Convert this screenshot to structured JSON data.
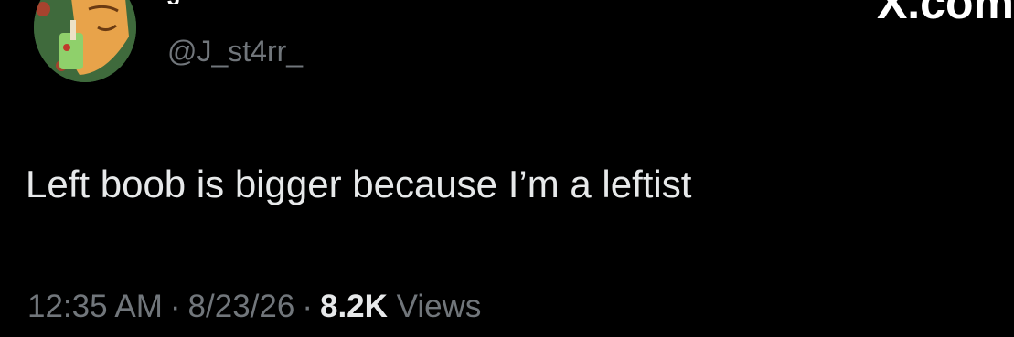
{
  "author": {
    "name_fragment": "J",
    "handle": "@J_st4rr_"
  },
  "watermark": "X.com",
  "tweet": {
    "text": "Left boob is bigger because I’m a leftist"
  },
  "meta": {
    "time": "12:35 AM",
    "separator": "·",
    "date": "8/23/26",
    "view_count": "8.2K",
    "views_label": "Views"
  },
  "colors": {
    "background": "#000000",
    "primary_text": "#e7e9ea",
    "secondary_text": "#71767b"
  }
}
